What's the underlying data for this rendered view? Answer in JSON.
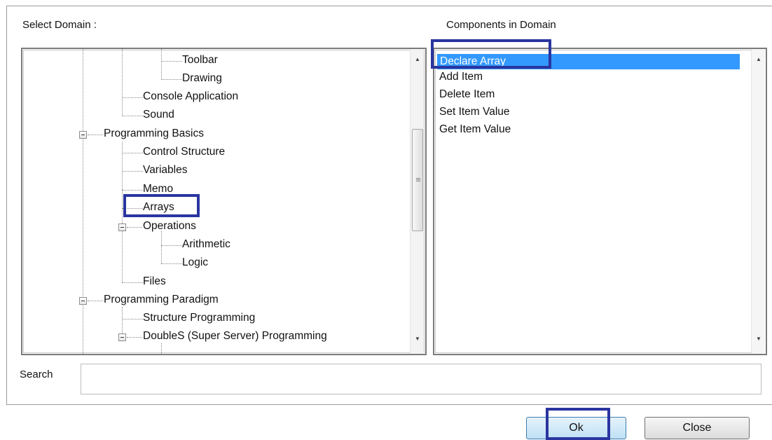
{
  "dialog": {
    "select_domain_label": "Select Domain :",
    "components_label": "Components in Domain",
    "search_label": "Search",
    "search_value": "",
    "ok_label": "Ok",
    "close_label": "Close"
  },
  "tree": {
    "nodes": [
      {
        "label": "Toolbar",
        "level": 3,
        "expander": "none"
      },
      {
        "label": "Drawing",
        "level": 3,
        "expander": "none"
      },
      {
        "label": "Console Application",
        "level": 2,
        "expander": "none"
      },
      {
        "label": "Sound",
        "level": 2,
        "expander": "none"
      },
      {
        "label": "Programming Basics",
        "level": 1,
        "expander": "expanded"
      },
      {
        "label": "Control Structure",
        "level": 2,
        "expander": "none"
      },
      {
        "label": "Variables",
        "level": 2,
        "expander": "none"
      },
      {
        "label": "Memo",
        "level": 2,
        "expander": "none"
      },
      {
        "label": "Arrays",
        "level": 2,
        "expander": "none",
        "highlighted": true
      },
      {
        "label": "Operations",
        "level": 2,
        "expander": "expanded"
      },
      {
        "label": "Arithmetic",
        "level": 3,
        "expander": "none"
      },
      {
        "label": "Logic",
        "level": 3,
        "expander": "none"
      },
      {
        "label": "Files",
        "level": 2,
        "expander": "none"
      },
      {
        "label": "Programming Paradigm",
        "level": 1,
        "expander": "expanded"
      },
      {
        "label": "Structure Programming",
        "level": 2,
        "expander": "none"
      },
      {
        "label": "DoubleS (Super Server) Programming",
        "level": 2,
        "expander": "expanded"
      }
    ]
  },
  "components": {
    "items": [
      {
        "label": "Declare Array",
        "selected": true
      },
      {
        "label": "Add Item",
        "selected": false
      },
      {
        "label": "Delete Item",
        "selected": false
      },
      {
        "label": "Set Item Value",
        "selected": false
      },
      {
        "label": "Get Item Value",
        "selected": false
      }
    ]
  },
  "colors": {
    "selection": "#3399ff",
    "annotation_box": "#2a35a0"
  }
}
